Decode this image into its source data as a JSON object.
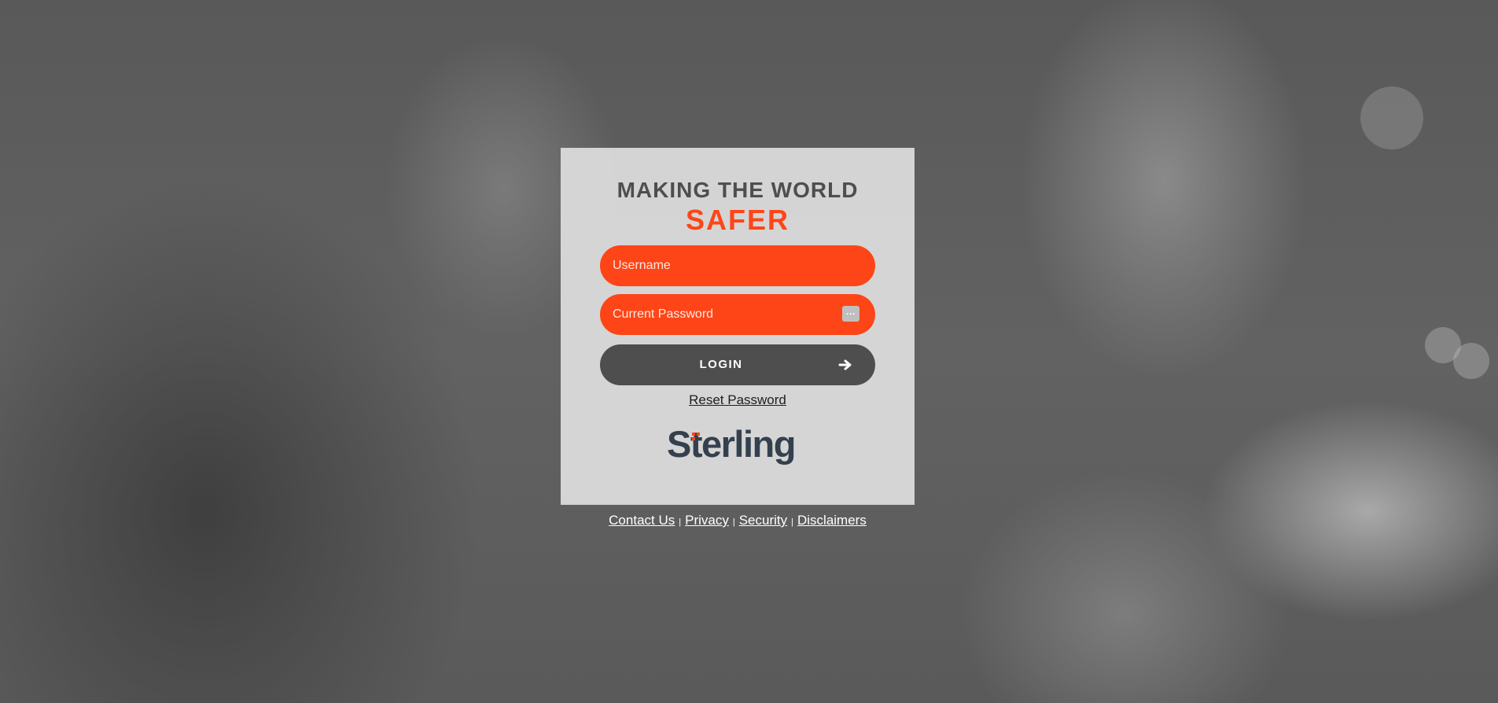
{
  "tagline": {
    "line1": "MAKING THE WORLD",
    "line2": "SAFER"
  },
  "login_form": {
    "username_placeholder": "Username",
    "password_placeholder": "Current Password",
    "login_label": "LOGIN",
    "reset_label": "Reset Password"
  },
  "logo": {
    "text": "Sterling"
  },
  "footer": {
    "links": [
      "Contact Us",
      "Privacy",
      "Security",
      "Disclaimers"
    ],
    "separator": "|"
  },
  "colors": {
    "accent": "#fe4517",
    "dark": "#4e4e4e",
    "logo_text": "#34404d"
  },
  "icons": {
    "login_arrow": "arrow-right-icon",
    "password_manager": "password-key-icon"
  }
}
